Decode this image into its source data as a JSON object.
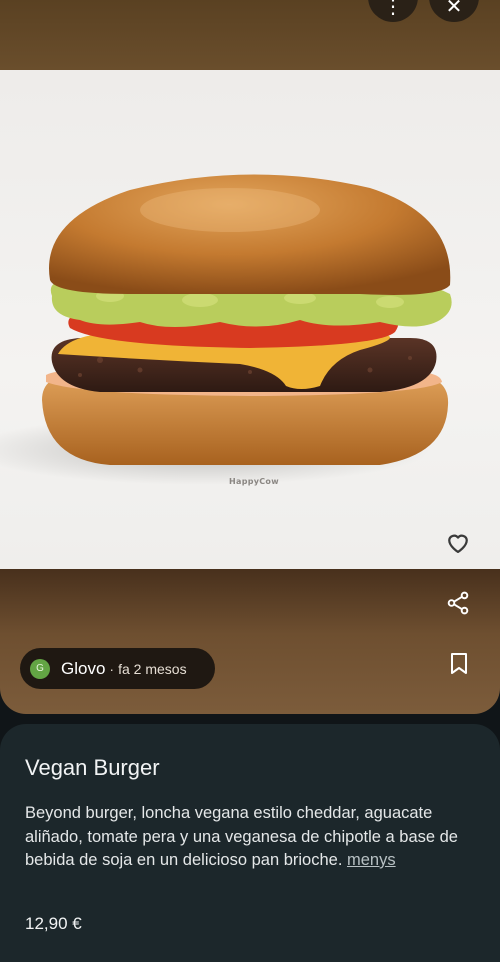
{
  "header": {
    "more_icon_glyph": "⋮",
    "close_icon_glyph": "✕"
  },
  "image": {
    "alt": "Vegan Burger",
    "watermark": "HappyCow"
  },
  "source": {
    "badge_letter": "G",
    "name": "Glovo",
    "separator": "·",
    "time": "fa 2 mesos"
  },
  "item": {
    "title": "Vegan Burger",
    "description": "Beyond burger, loncha vegana estilo cheddar, aguacate aliñado, tomate pera y una veganesa de chipotle a base de bebida de soja en un delicioso pan brioche.",
    "more_label": "menys",
    "price": "12,90 €"
  },
  "colors": {
    "brand_green": "#63a544",
    "card_bg": "#1c272b",
    "panel_brown": "#6e4f30"
  }
}
